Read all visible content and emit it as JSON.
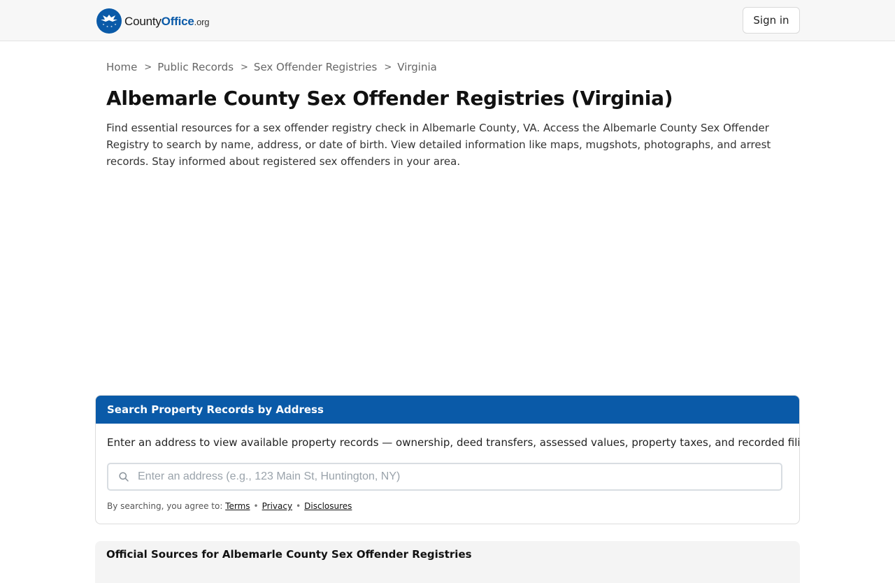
{
  "header": {
    "logo": {
      "county": "County",
      "office": "Office",
      "tld": ".org"
    },
    "signin_label": "Sign in"
  },
  "breadcrumb": {
    "items": [
      "Home",
      "Public Records",
      "Sex Offender Registries",
      "Virginia"
    ],
    "separator": ">"
  },
  "page": {
    "title": "Albemarle County Sex Offender Registries (Virginia)",
    "intro": "Find essential resources for a sex offender registry check in Albemarle County, VA. Access the Albemarle County Sex Offender Registry to search by name, address, or date of birth. View detailed information like maps, mugshots, photographs, and arrest records. Stay informed about registered sex offenders in your area."
  },
  "search_card": {
    "title": "Search Property Records by Address",
    "description": "Enter an address to view available property records — ownership, deed transfers, assessed values, property taxes, and recorded filings.",
    "input_value": "",
    "placeholder": "Enter an address (e.g., 123 Main St, Huntington, NY)",
    "agree_prefix": "By searching, you agree to:",
    "links": [
      "Terms",
      "Privacy",
      "Disclosures"
    ],
    "link_separator": "•"
  },
  "sources": {
    "title": "Official Sources for Albemarle County Sex Offender Registries"
  },
  "colors": {
    "brand": "#0a5aa8",
    "header_bg": "#f7f7f7"
  },
  "icons": {
    "logo": "eagle-seal-icon",
    "search": "search-icon"
  }
}
